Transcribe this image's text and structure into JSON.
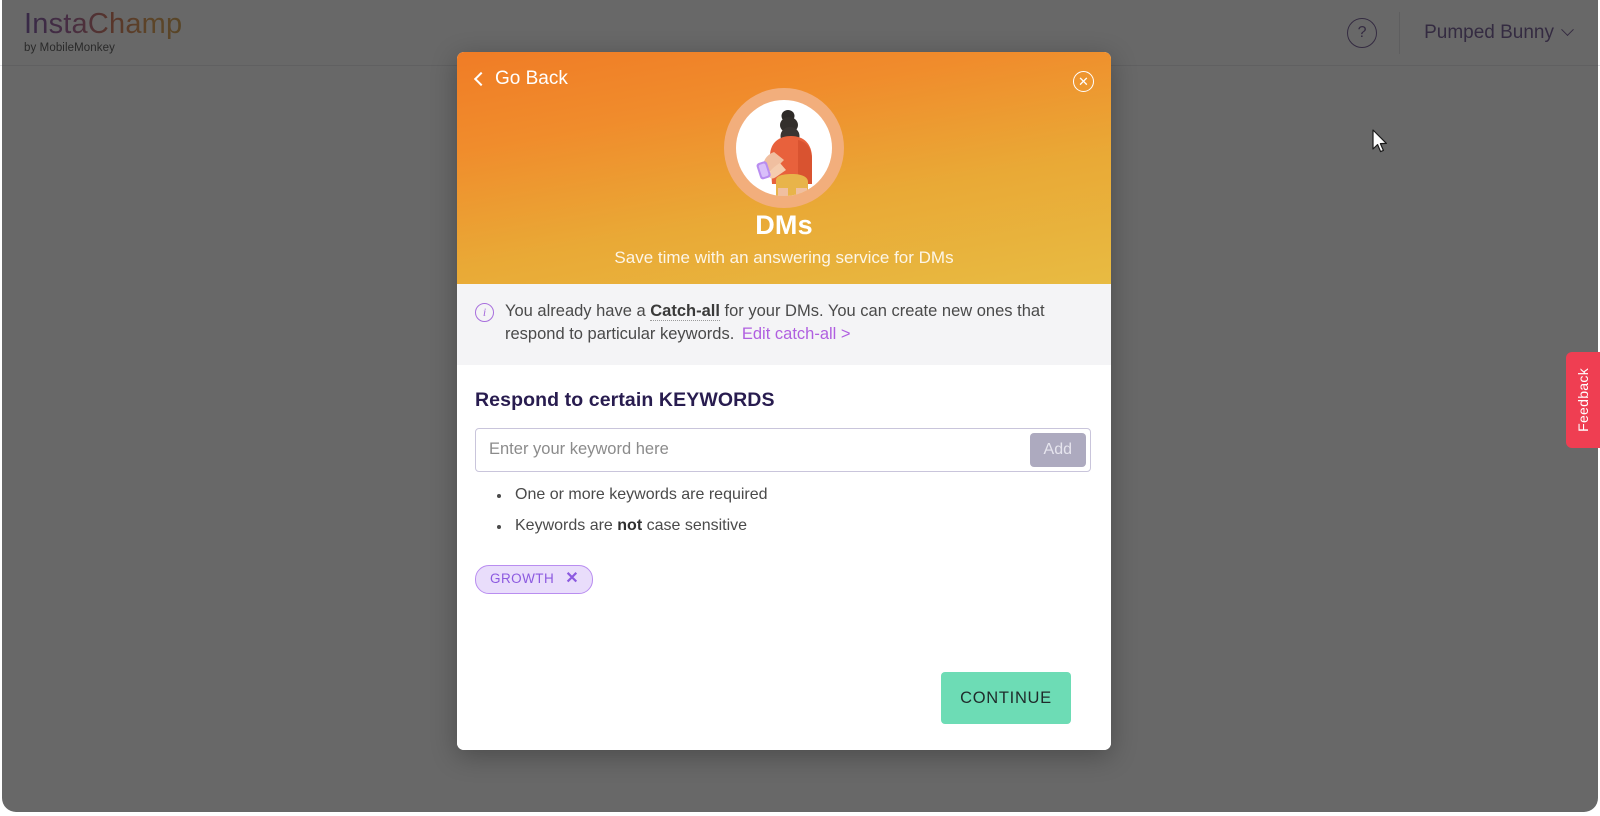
{
  "header": {
    "brand_name": "InstaChamp",
    "brand_sub": "by MobileMonkey",
    "help_icon": "question-mark-circle-icon",
    "account_label": "Pumped Bunny",
    "account_chevron": "chevron-down-icon"
  },
  "modal": {
    "go_back_label": "Go Back",
    "go_back_icon": "chevron-left-icon",
    "close_icon": "close-circle-icon",
    "avatar_icon": "person-with-phone-illustration",
    "title": "DMs",
    "subtitle": "Save time with an answering service for DMs",
    "info": {
      "icon": "info-circle-icon",
      "text_before": "You already have a ",
      "term": "Catch-all",
      "text_after": " for your DMs. You can create new ones that respond to particular keywords.",
      "link_label": "Edit catch-all >"
    },
    "section_heading": "Respond to certain KEYWORDS",
    "keyword_input": {
      "value": "",
      "placeholder": "Enter your keyword here"
    },
    "add_button_label": "Add",
    "hints": [
      {
        "prefix": "One or more keywords are required",
        "bold": "",
        "suffix": ""
      },
      {
        "prefix": "Keywords are ",
        "bold": "not",
        "suffix": " case sensitive"
      }
    ],
    "keywords": [
      {
        "label": "GROWTH",
        "remove_icon": "close-x-icon"
      }
    ],
    "continue_label": "CONTINUE"
  },
  "feedback": {
    "label": "Feedback"
  },
  "colors": {
    "hero_gradient_start": "#f07c26",
    "hero_gradient_end": "#e8bb42",
    "brand_purple": "#51327d",
    "link_purple": "#b05fe0",
    "chip_bg": "#e9ddfb",
    "chip_border": "#b98df0",
    "chip_text": "#8c5ae0",
    "continue_green": "#6ddcb5",
    "feedback_red": "#ef3e52",
    "add_disabled": "#adaabf",
    "overlay": "rgba(40,40,40,0.70)"
  }
}
